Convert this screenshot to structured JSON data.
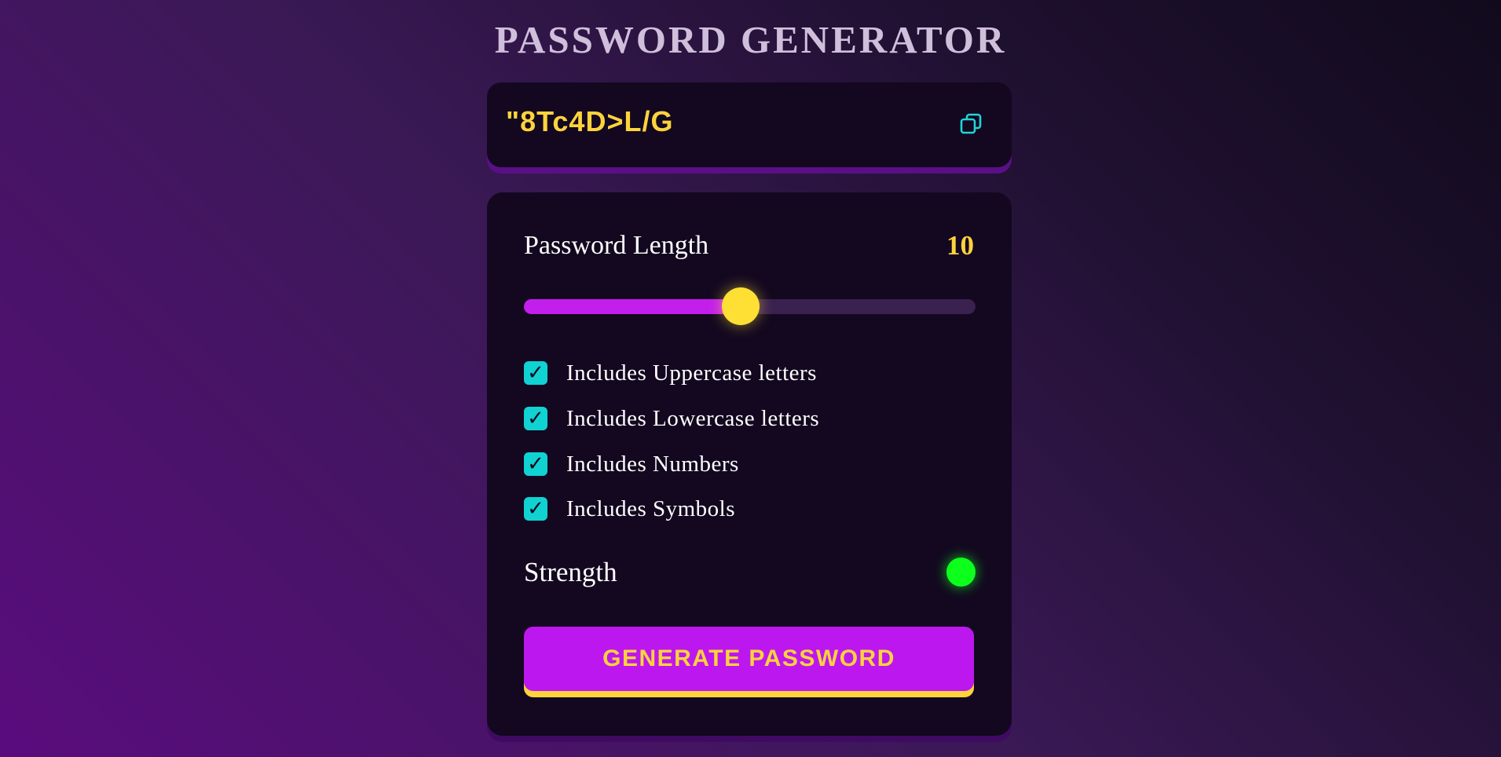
{
  "app": {
    "title": "PASSWORD GENERATOR"
  },
  "display": {
    "password": "\"8Tc4D>L/G",
    "copy_icon": "copy-icon"
  },
  "length": {
    "label": "Password Length",
    "value": "10",
    "slider_fraction": 0.48
  },
  "options": [
    {
      "label": "Includes Uppercase letters",
      "checked": true
    },
    {
      "label": "Includes Lowercase letters",
      "checked": true
    },
    {
      "label": "Includes Numbers",
      "checked": true
    },
    {
      "label": "Includes Symbols",
      "checked": true
    }
  ],
  "strength": {
    "label": "Strength",
    "indicator_color": "#0dff1c"
  },
  "actions": {
    "generate_label": "GENERATE PASSWORD"
  },
  "colors": {
    "accent_yellow": "#fdd33c",
    "accent_purple": "#bd17ef",
    "checkbox_teal": "#10d2d2",
    "panel_bg": "#130820"
  }
}
